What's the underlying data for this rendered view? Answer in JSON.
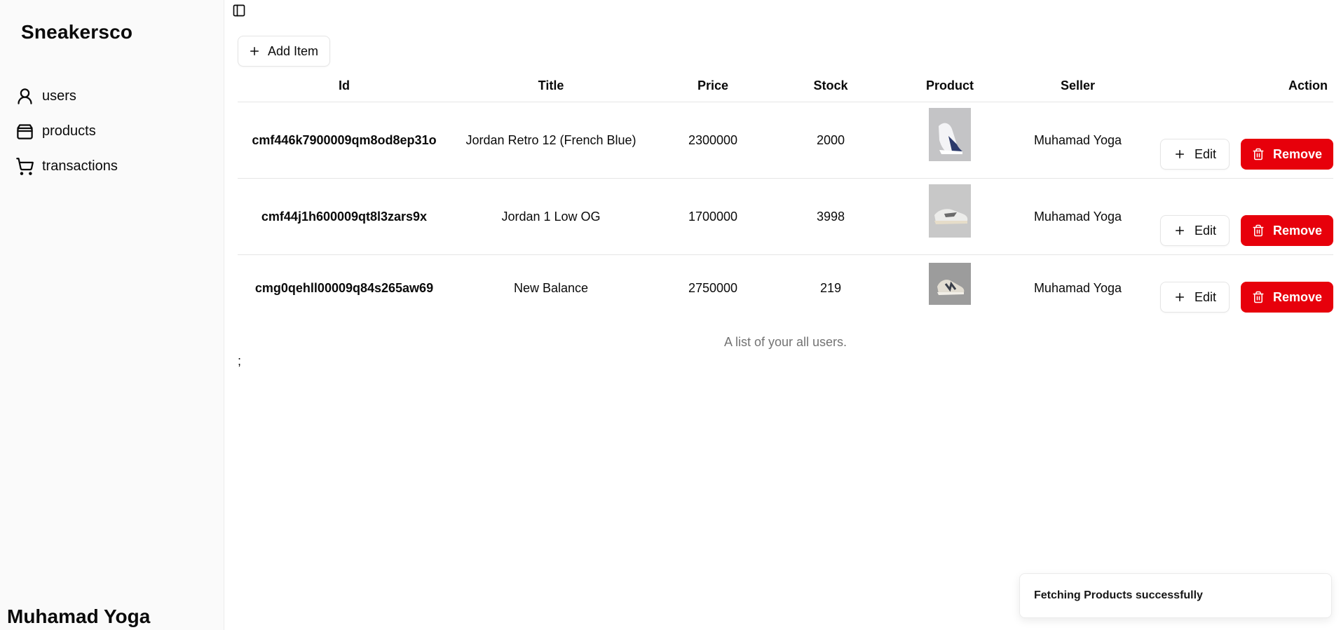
{
  "app": {
    "brand": "Sneakersco"
  },
  "sidebar": {
    "items": [
      {
        "label": "users",
        "icon": "user-icon"
      },
      {
        "label": "products",
        "icon": "package-icon"
      },
      {
        "label": "transactions",
        "icon": "cart-icon"
      }
    ],
    "footer_user": "Muhamad Yoga"
  },
  "toolbar": {
    "add_label": "Add Item"
  },
  "table": {
    "columns": [
      "Id",
      "Title",
      "Price",
      "Stock",
      "Product",
      "Seller",
      "Action"
    ],
    "rows": [
      {
        "id": "cmf446k7900009qm8od8ep31o",
        "title": "Jordan Retro 12 (French Blue)",
        "price": "2300000",
        "stock": "2000",
        "product_image": "sneaker-thumbnail",
        "seller": "Muhamad Yoga",
        "edit_label": "Edit",
        "remove_label": "Remove"
      },
      {
        "id": "cmf44j1h600009qt8l3zars9x",
        "title": "Jordan 1 Low OG",
        "price": "1700000",
        "stock": "3998",
        "product_image": "sneaker-thumbnail",
        "seller": "Muhamad Yoga",
        "edit_label": "Edit",
        "remove_label": "Remove"
      },
      {
        "id": "cmg0qehll00009q84s265aw69",
        "title": "New Balance",
        "price": "2750000",
        "stock": "219",
        "product_image": "sneaker-thumbnail",
        "seller": "Muhamad Yoga",
        "edit_label": "Edit",
        "remove_label": "Remove"
      }
    ],
    "caption": "A list of your all users."
  },
  "stray_text": ";",
  "toast": {
    "message": "Fetching Products successfully"
  },
  "colors": {
    "danger": "#e7000b",
    "sidebar_bg": "#fafafa",
    "border": "#e5e5e5",
    "muted_text": "#737373"
  }
}
